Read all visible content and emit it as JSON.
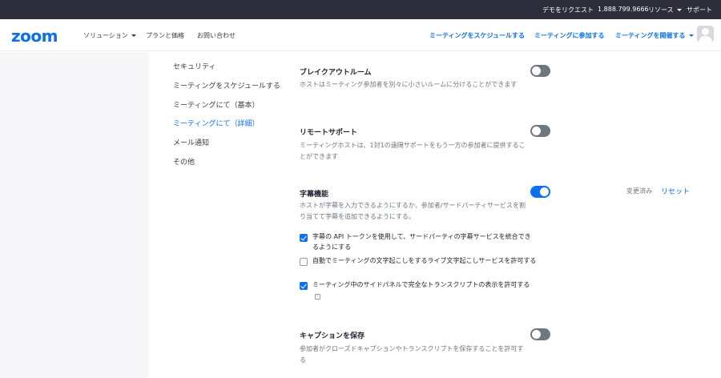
{
  "top_bar": {
    "request_demo": "デモをリクエスト",
    "phone": "1.888.799.9666",
    "resources": "リソース",
    "support": "サポート"
  },
  "header": {
    "logo": "zoom",
    "solutions": "ソリューション",
    "plans": "プランと価格",
    "contact": "お問い合わせ",
    "schedule": "ミーティングをスケジュールする",
    "join": "ミーティングに参加する",
    "host": "ミーティングを開催する"
  },
  "sidebar": {
    "items": [
      {
        "label": "セキュリティ"
      },
      {
        "label": "ミーティングをスケジュールする"
      },
      {
        "label": "ミーティングにて（基本）"
      },
      {
        "label": "ミーティングにて（詳細）"
      },
      {
        "label": "メール通知"
      },
      {
        "label": "その他"
      }
    ]
  },
  "settings": {
    "breakout": {
      "title": "ブレイクアウトルーム",
      "desc": "ホストはミーティング参加者を別々に小さいルームに分けることができます",
      "enabled": false
    },
    "remote_support": {
      "title": "リモートサポート",
      "desc": "ミーティングホストは、1対1の遠隔サポートをもう一方の参加者に提供することができます",
      "enabled": false
    },
    "captions": {
      "title": "字幕機能",
      "desc": "ホストが字幕を入力できるようにするか、参加者/サードパーティサービスを割り当てて字幕を追加できるようにする。",
      "enabled": true,
      "changed": "変更済み",
      "reset": "リセット",
      "options": [
        {
          "label": "字幕の API トークンを使用して、サードパーティの字幕サービスを統合できるようにする",
          "checked": true
        },
        {
          "label": "自動でミーティングの文字起こしをするライブ文字起こしサービスを許可する",
          "checked": false
        },
        {
          "label": "ミーティング中のサイドパネルで完全なトランスクリプトの表示を許可する",
          "checked": true
        }
      ]
    },
    "save_captions": {
      "title": "キャプションを保存",
      "desc": "参加者がクローズドキャプションやトランスクリプトを保存することを許可する",
      "enabled": false
    }
  },
  "colors": {
    "accent": "#0e71eb",
    "topbar": "#2d2d3b",
    "toggle_off": "#6e7680"
  }
}
